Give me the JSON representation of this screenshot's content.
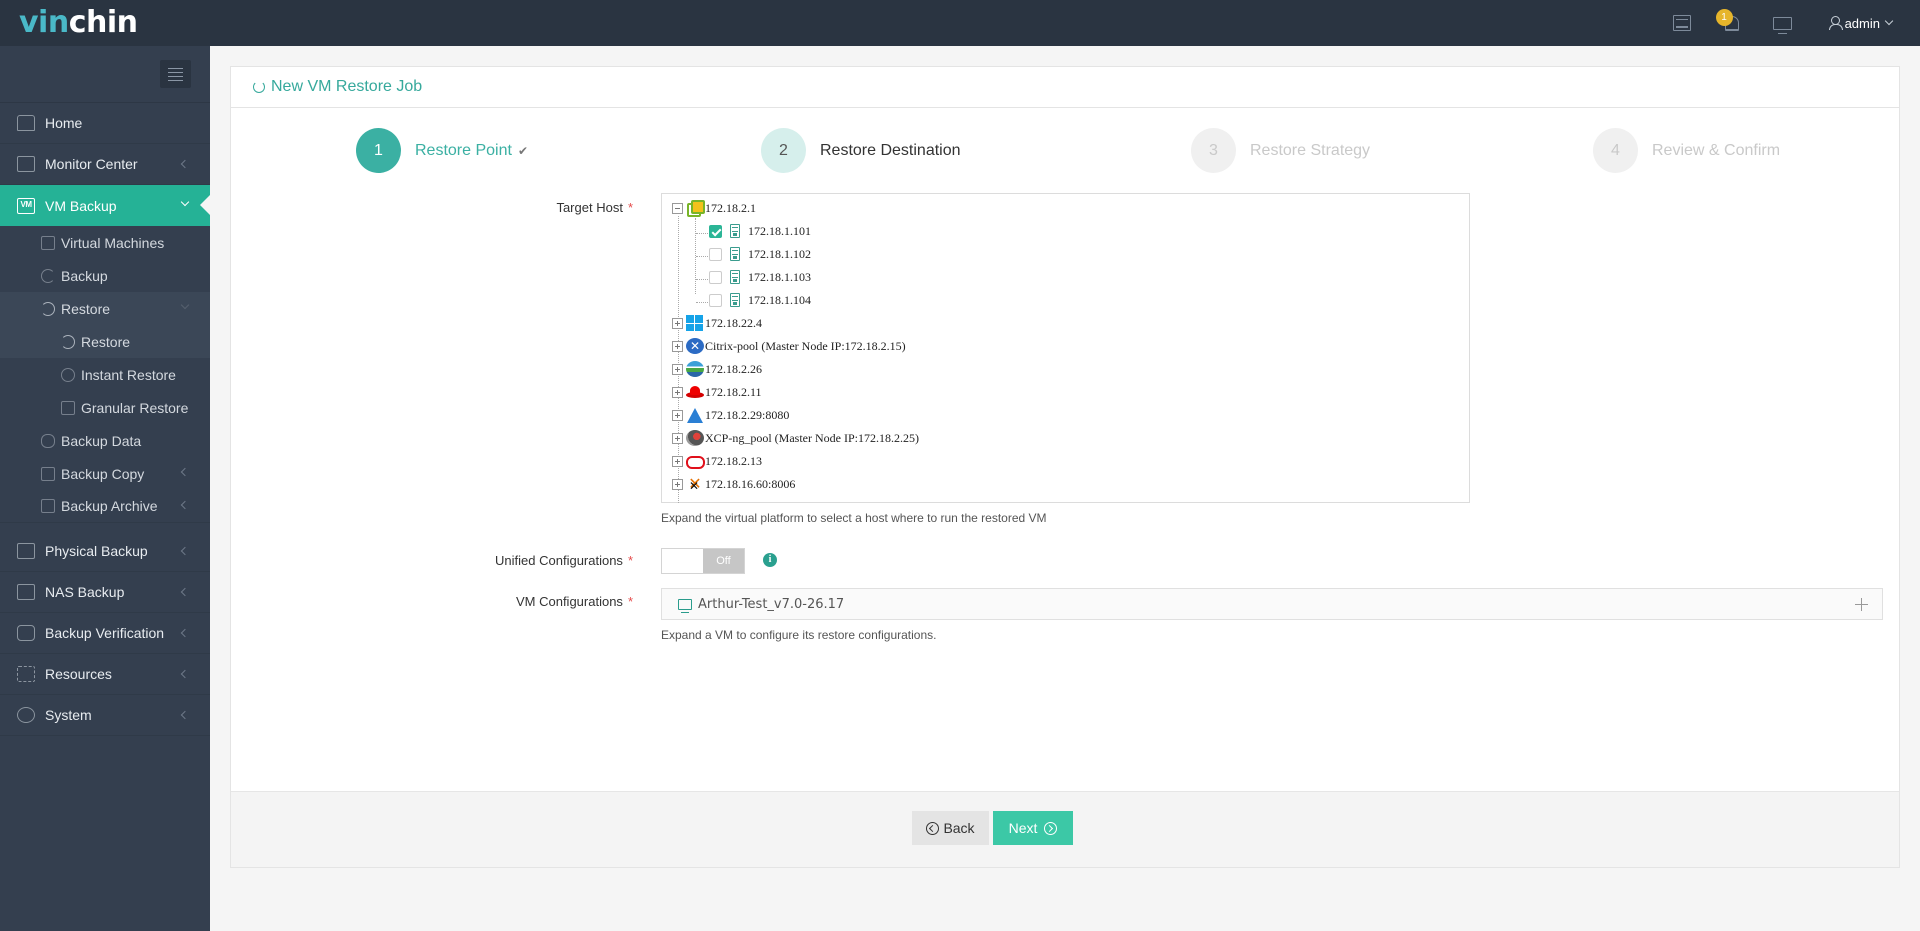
{
  "header": {
    "logo_part1": "vin",
    "logo_part2": "chin",
    "notification_count": "1",
    "user_name": "admin",
    "icons": [
      "task-list-icon",
      "bell-icon",
      "monitor-icon",
      "user-icon"
    ]
  },
  "sidebar": {
    "items": [
      {
        "label": "Home",
        "icon": "home-icon"
      },
      {
        "label": "Monitor Center",
        "icon": "monitor-center-icon"
      },
      {
        "label": "VM Backup",
        "icon": "vm-icon",
        "active": true
      }
    ],
    "vm_backup_sub": [
      {
        "label": "Virtual Machines",
        "icon": "virtual-machines-icon"
      },
      {
        "label": "Backup",
        "icon": "backup-icon"
      },
      {
        "label": "Restore",
        "icon": "restore-icon",
        "expanded": true
      }
    ],
    "restore_sub": [
      {
        "label": "Restore",
        "icon": "restore-icon",
        "selected": true
      },
      {
        "label": "Instant Restore",
        "icon": "instant-restore-icon"
      },
      {
        "label": "Granular Restore",
        "icon": "granular-restore-icon"
      }
    ],
    "vm_backup_sub2": [
      {
        "label": "Backup Data",
        "icon": "database-icon"
      },
      {
        "label": "Backup Copy",
        "icon": "copy-icon"
      },
      {
        "label": "Backup Archive",
        "icon": "archive-icon"
      }
    ],
    "lower_items": [
      {
        "label": "Physical Backup",
        "icon": "physical-backup-icon"
      },
      {
        "label": "NAS Backup",
        "icon": "nas-icon"
      },
      {
        "label": "Backup Verification",
        "icon": "shield-check-icon"
      },
      {
        "label": "Resources",
        "icon": "resources-icon"
      },
      {
        "label": "System",
        "icon": "gear-icon"
      }
    ]
  },
  "panel": {
    "title": "New VM Restore Job",
    "steps": [
      {
        "num": "1",
        "label": "Restore Point",
        "status": "done"
      },
      {
        "num": "2",
        "label": "Restore Destination",
        "status": "current"
      },
      {
        "num": "3",
        "label": "Restore Strategy",
        "status": "pending"
      },
      {
        "num": "4",
        "label": "Review & Confirm",
        "status": "pending"
      }
    ]
  },
  "form": {
    "target_host_label": "Target Host",
    "unified_label": "Unified Configurations",
    "vm_config_label": "VM Configurations",
    "required_mark": "*",
    "tree": {
      "root": {
        "label": "172.18.2.1",
        "platform": "vmware",
        "expanded": true
      },
      "children": [
        {
          "label": "172.18.1.101",
          "checked": true
        },
        {
          "label": "172.18.1.102",
          "checked": false
        },
        {
          "label": "172.18.1.103",
          "checked": false
        },
        {
          "label": "172.18.1.104",
          "checked": false
        }
      ],
      "others": [
        {
          "label": "172.18.22.4",
          "platform": "hyper-v"
        },
        {
          "label": "Citrix-pool (Master Node IP:172.18.2.15)",
          "platform": "citrix"
        },
        {
          "label": "172.18.2.26",
          "platform": "oVirt"
        },
        {
          "label": "172.18.2.11",
          "platform": "redhat"
        },
        {
          "label": "172.18.2.29:8080",
          "platform": "azure-stack"
        },
        {
          "label": "XCP-ng_pool (Master Node IP:172.18.2.25)",
          "platform": "xcp-ng"
        },
        {
          "label": "172.18.2.13",
          "platform": "oracle"
        },
        {
          "label": "172.18.16.60:8006",
          "platform": "proxmox"
        }
      ]
    },
    "tree_hint": "Expand the virtual platform to select a host where to run the restored VM",
    "unified_toggle_state": "Off",
    "info_glyph": "i",
    "vm_name": "Arthur-Test_v7.0-26.17",
    "vm_hint": "Expand a VM to configure its restore configurations."
  },
  "footer": {
    "back_label": "Back",
    "next_label": "Next"
  },
  "colors": {
    "accent": "#25b296",
    "topbar": "#2a3441",
    "sidebar": "#343f4f",
    "step_done": "#3bb0a3",
    "next_button": "#3cc8a6",
    "badge": "#e6b52b"
  }
}
